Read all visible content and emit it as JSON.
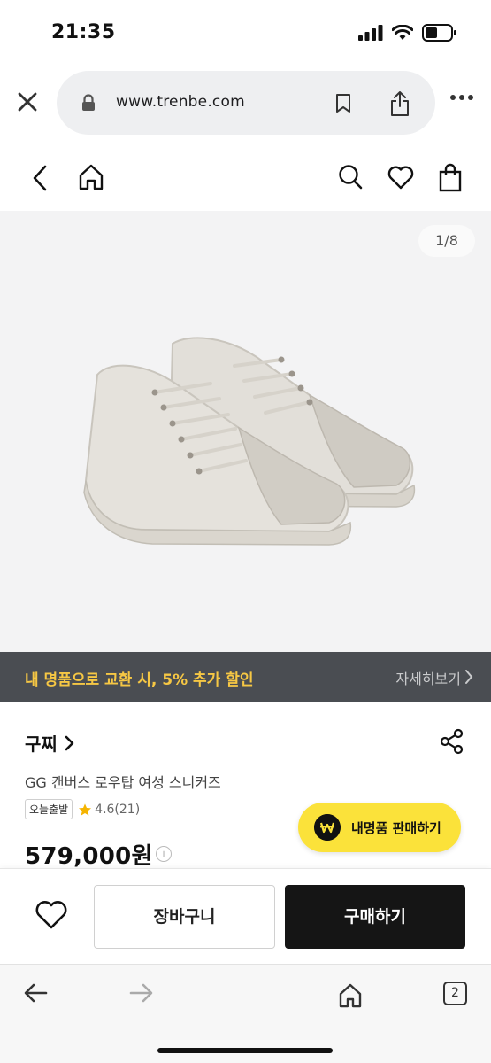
{
  "status_bar": {
    "time": "21:35"
  },
  "browser": {
    "url": "www.trenbe.com",
    "tab_count": "2"
  },
  "product_image": {
    "page_counter": "1/8"
  },
  "promo": {
    "text": "내 명품으로 교환 시, 5% 추가 할인",
    "link": "자세히보기"
  },
  "product": {
    "brand": "구찌",
    "name": "GG 캔버스 로우탑 여성 스니커즈",
    "badge": "오늘출발",
    "rating": "4.6(21)",
    "price": "579,000원"
  },
  "sell_button": {
    "label": "내명품 판매하기"
  },
  "actions": {
    "cart_label": "장바구니",
    "buy_label": "구매하기"
  },
  "colors": {
    "promo_text": "#f6c744",
    "sell_button": "#fbe23a",
    "buy_button": "#151515",
    "star": "#f5b400"
  }
}
